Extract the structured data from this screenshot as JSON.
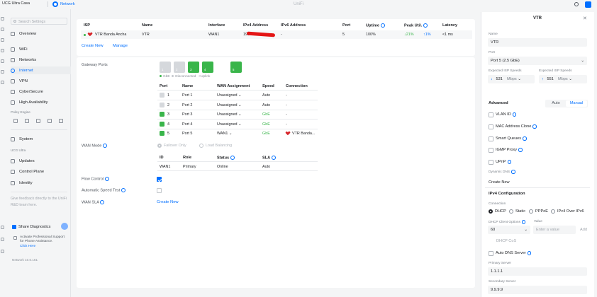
{
  "topbar": {
    "site_name": "UCG Ultra Casa",
    "app_name": "Network",
    "window_title": "UniFi"
  },
  "sidebar": {
    "search_placeholder": "Search Settings",
    "items": [
      {
        "label": "Overview"
      },
      {
        "label": "WiFi"
      },
      {
        "label": "Networks"
      },
      {
        "label": "Internet"
      },
      {
        "label": "VPN"
      },
      {
        "label": "CyberSecure"
      },
      {
        "label": "High Availability"
      }
    ],
    "policy_engine_label": "Policy Engine",
    "system_label": "System",
    "device_section": "UCG Ultra",
    "device_items": [
      {
        "label": "Updates"
      },
      {
        "label": "Control Plane"
      },
      {
        "label": "Identity"
      }
    ],
    "feedback_text": "Give feedback directly to the UniFi R&D team here.",
    "share_label": "Share Diagnostics",
    "support_text": "Activate Professional Support for Phone Assistance.",
    "support_link": "Click Here",
    "network_version": "Network 10.0.161",
    "accent_color": "#006fff"
  },
  "isp_table": {
    "headers": [
      "ISP",
      "Name",
      "Interface",
      "IPv4 Address",
      "IPv6 Address",
      "Port",
      "Uptime",
      "Peak Util.",
      "Latency"
    ],
    "row": {
      "isp": "VTR Banda Ancha",
      "name": "VTR",
      "interface": "WAN1",
      "ipv4": "190.",
      "ipv6": "-",
      "port": "5",
      "uptime": "100%",
      "peak_down": "↓21%",
      "peak_up": "↑1%",
      "latency": "<1 ms"
    },
    "create_new": "Create New",
    "manage": "Manage"
  },
  "config": {
    "gateway_ports_label": "Gateway Ports",
    "ports_visual": [
      "1",
      "2",
      "3",
      "4",
      "5"
    ],
    "legend": [
      "GbE",
      "Disconnected",
      "Uplink"
    ],
    "port_headers": [
      "Port",
      "Name",
      "WAN Assignment",
      "Speed",
      "Connection"
    ],
    "ports": [
      {
        "num": "1",
        "name": "Port 1",
        "wan": "Unassigned",
        "speed": "Auto",
        "connection": "-"
      },
      {
        "num": "2",
        "name": "Port 2",
        "wan": "Unassigned",
        "speed": "Auto",
        "connection": "-"
      },
      {
        "num": "3",
        "name": "Port 3",
        "wan": "Unassigned",
        "speed": "GbE",
        "connection": "-"
      },
      {
        "num": "4",
        "name": "Port 4",
        "wan": "Unassigned",
        "speed": "GbE",
        "connection": "-"
      },
      {
        "num": "5",
        "name": "Port 5",
        "wan": "WAN1",
        "speed": "GbE",
        "connection": "VTR Banda..."
      }
    ],
    "wan_mode_label": "WAN Mode",
    "wan_mode_options": [
      "Failover Only",
      "Load Balancing"
    ],
    "wan_headers": [
      "ID",
      "Role",
      "Status",
      "SLA"
    ],
    "wan_row": {
      "id": "WAN1",
      "role": "Primary",
      "status": "Online",
      "sla": "Auto"
    },
    "flow_control_label": "Flow Control",
    "auto_speed_label": "Automatic Speed Test",
    "wan_sla_label": "WAN SLA",
    "wan_sla_link": "Create New"
  },
  "panel": {
    "title": "VTR",
    "name_label": "Name",
    "name_value": "VTR",
    "port_label": "Port",
    "port_value": "Port 5 (2.5 GbE)",
    "down_label": "Expected ISP Speeds",
    "down_value": "531",
    "down_unit": "Mbps",
    "up_label": "Expected ISP Speeds",
    "up_value": "551",
    "up_unit": "Mbps",
    "advanced_label": "Advanced",
    "adv_auto": "Auto",
    "adv_manual": "Manual",
    "checks": [
      "VLAN ID",
      "MAC Address Clone",
      "Smart Queues",
      "IGMP Proxy",
      "UPnP"
    ],
    "dynamic_dns_label": "Dynamic DNS",
    "create_new": "Create New",
    "ipv4_label": "IPv4 Configuration",
    "connection_label": "Connection",
    "connection_options": [
      "DHCP",
      "Static",
      "PPPoE",
      "IPv4 Over IPv6"
    ],
    "dhcp_opt_label": "DHCP Client Options",
    "dhcp_opt_value": "60",
    "value_label": "Value",
    "value_placeholder": "Enter a value",
    "add_label": "Add",
    "dhcp_cos": "DHCP CoS",
    "auto_dns_label": "Auto DNS Server",
    "primary_label": "Primary Server",
    "primary_value": "1.1.1.1",
    "secondary_label": "Secondary Server",
    "secondary_value": "9.9.9.9"
  }
}
